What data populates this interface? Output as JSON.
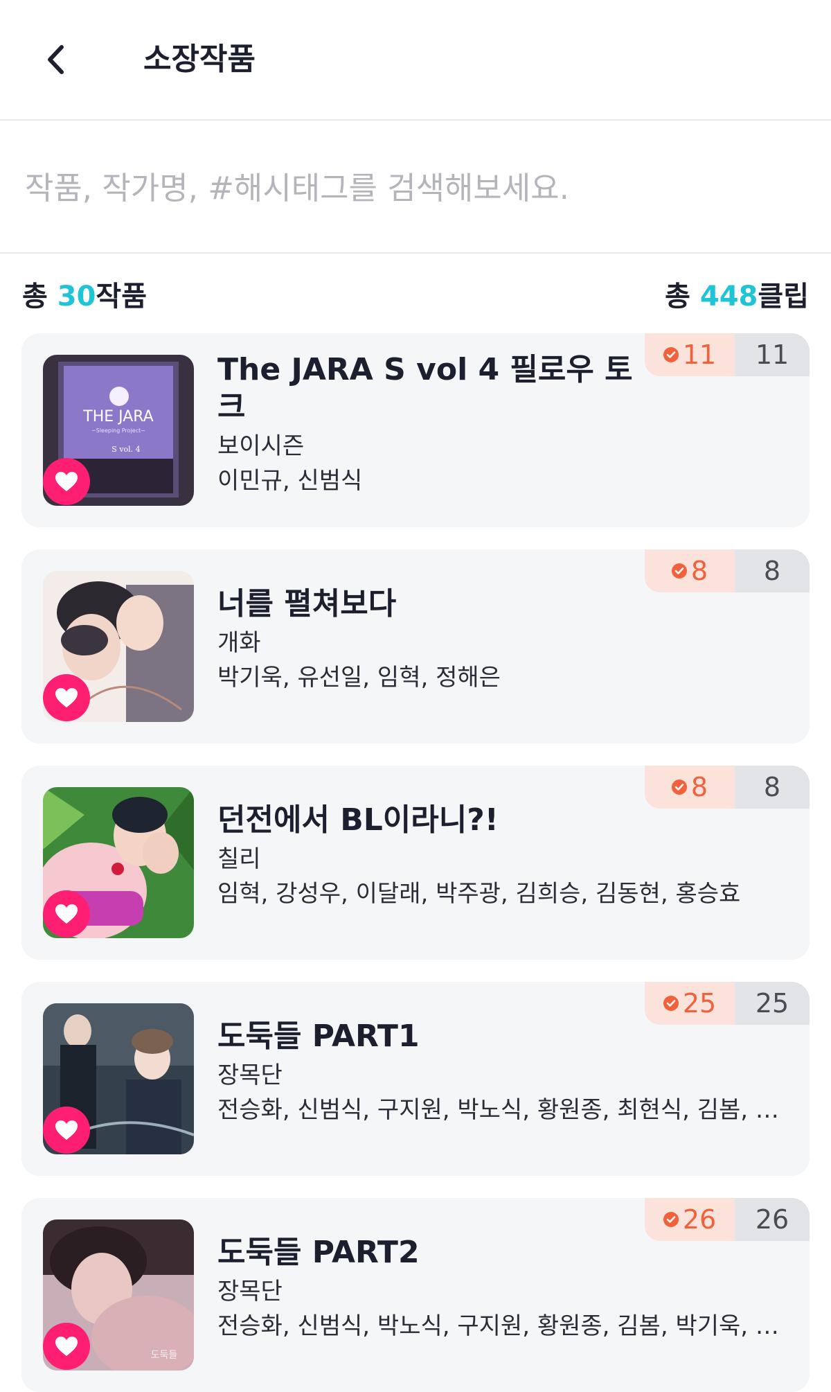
{
  "header": {
    "title": "소장작품"
  },
  "search": {
    "placeholder": "작품, 작가명, #해시태그를 검색해보세요."
  },
  "summary": {
    "works_prefix": "총 ",
    "works_count": "30",
    "works_suffix": "작품",
    "clips_prefix": "총 ",
    "clips_count": "448",
    "clips_suffix": "클립"
  },
  "colors": {
    "accent": "#1fc4d6",
    "heart": "#ff1f72",
    "badge_owned": "#f0613c"
  },
  "items": [
    {
      "title": "The JARA S vol 4 필로우 토크",
      "publisher": "보이시즌",
      "authors": "이민규, 신범식",
      "owned": "11",
      "total": "11",
      "cover_text": "THE JARA",
      "cover_sub": "~Sleeping Project~",
      "cover_vol": "S vol. 4"
    },
    {
      "title": "너를 펼쳐보다",
      "publisher": "개화",
      "authors": "박기욱, 유선일, 임혁, 정해은",
      "owned": "8",
      "total": "8"
    },
    {
      "title": "던전에서 BL이라니?!",
      "publisher": "칠리",
      "authors": "임혁, 강성우, 이달래, 박주광, 김희승, 김동현, 홍승효",
      "owned": "8",
      "total": "8"
    },
    {
      "title": "도둑들 PART1",
      "publisher": "장목단",
      "authors": "전승화, 신범식, 구지원, 박노식, 황원종, 최현식, 김봄, …",
      "owned": "25",
      "total": "25"
    },
    {
      "title": "도둑들 PART2",
      "publisher": "장목단",
      "authors": "전승화, 신범식, 박노식, 구지원, 황원종, 김봄, 박기욱, …",
      "owned": "26",
      "total": "26",
      "cover_text": "도둑들"
    }
  ]
}
